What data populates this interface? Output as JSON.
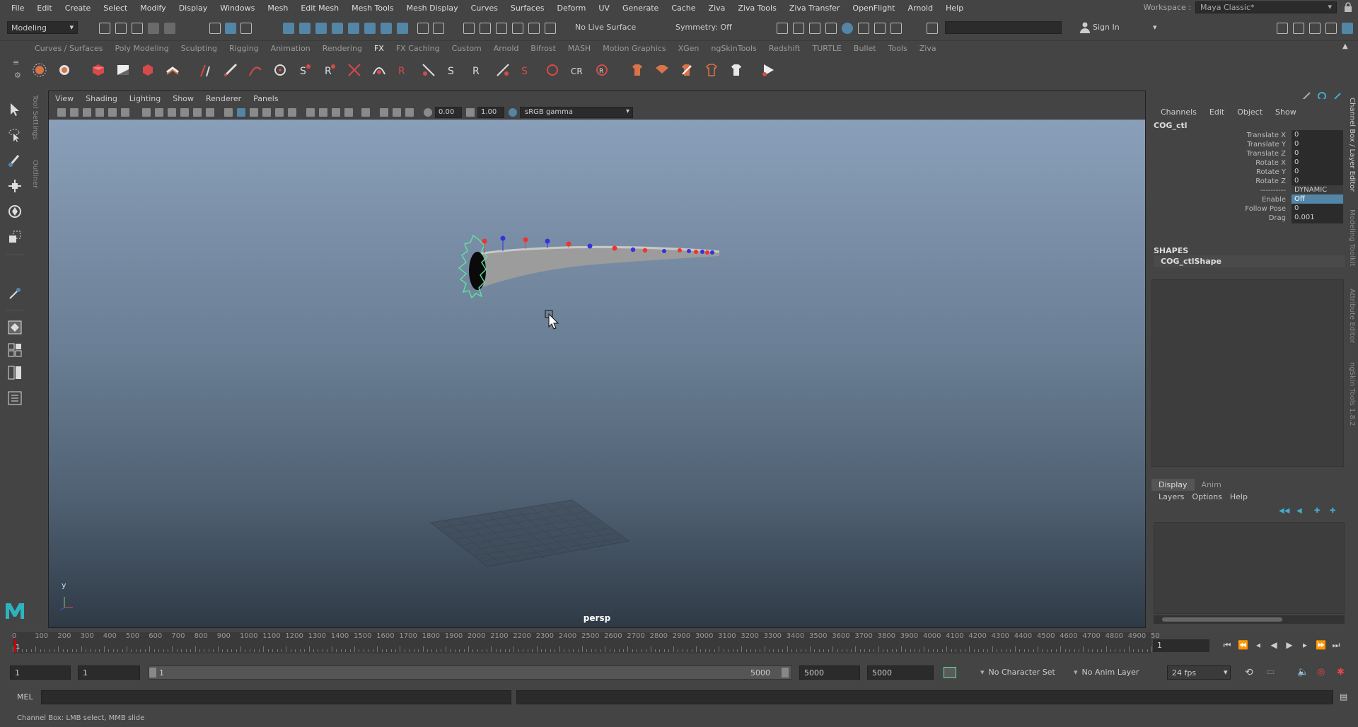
{
  "menubar": {
    "items": [
      "File",
      "Edit",
      "Create",
      "Select",
      "Modify",
      "Display",
      "Windows",
      "Mesh",
      "Edit Mesh",
      "Mesh Tools",
      "Mesh Display",
      "Curves",
      "Surfaces",
      "Deform",
      "UV",
      "Generate",
      "Cache",
      "Ziva",
      "Ziva Tools",
      "Ziva Transfer",
      "OpenFlight",
      "Arnold",
      "Help"
    ],
    "workspace_label": "Workspace :",
    "workspace_value": "Maya Classic*"
  },
  "statusline": {
    "mode": "Modeling",
    "live_surface": "No Live Surface",
    "symmetry": "Symmetry: Off",
    "sign_in": "Sign In"
  },
  "shelf": {
    "tabs": [
      "Curves / Surfaces",
      "Poly Modeling",
      "Sculpting",
      "Rigging",
      "Animation",
      "Rendering",
      "FX",
      "FX Caching",
      "Custom",
      "Arnold",
      "Bifrost",
      "MASH",
      "Motion Graphics",
      "XGen",
      "ngSkinTools",
      "Redshift",
      "TURTLE",
      "Bullet",
      "Tools",
      "Ziva"
    ],
    "active_tab": "FX"
  },
  "side_tabs": {
    "tool_settings": "Tool Settings",
    "outliner": "Outliner",
    "channel_box": "Channel Box / Layer Editor",
    "modeling_toolkit": "Modeling Toolkit",
    "attribute_editor": "Attribute Editor",
    "ngskin": "ngSkin Tools 1.8.2"
  },
  "viewport": {
    "menus": [
      "View",
      "Shading",
      "Lighting",
      "Show",
      "Renderer",
      "Panels"
    ],
    "exposure": "0.00",
    "gamma": "1.00",
    "color_space": "sRGB gamma",
    "camera": "persp",
    "axis_y": "y"
  },
  "channelbox": {
    "menus": [
      "Channels",
      "Edit",
      "Object",
      "Show"
    ],
    "object": "COG_ctl",
    "attributes": [
      {
        "label": "Translate X",
        "value": "0"
      },
      {
        "label": "Translate Y",
        "value": "0"
      },
      {
        "label": "Translate Z",
        "value": "0"
      },
      {
        "label": "Rotate X",
        "value": "0"
      },
      {
        "label": "Rotate Y",
        "value": "0"
      },
      {
        "label": "Rotate Z",
        "value": "0"
      },
      {
        "label": "----------",
        "value": "DYNAMIC"
      },
      {
        "label": "Enable",
        "value": "Off"
      },
      {
        "label": "Follow Pose",
        "value": "0"
      },
      {
        "label": "Drag",
        "value": "0.001"
      }
    ],
    "shapes_header": "SHAPES",
    "shape": "COG_ctlShape"
  },
  "layereditor": {
    "tabs": [
      "Display",
      "Anim"
    ],
    "active_tab": "Display",
    "menus": [
      "Layers",
      "Options",
      "Help"
    ]
  },
  "timeslider": {
    "ticks": [
      "0",
      "100",
      "200",
      "300",
      "400",
      "500",
      "600",
      "700",
      "800",
      "900",
      "1000",
      "1100",
      "1200",
      "1300",
      "1400",
      "1500",
      "1600",
      "1700",
      "1800",
      "1900",
      "2000",
      "2100",
      "2200",
      "2300",
      "2400",
      "2500",
      "2600",
      "2700",
      "2800",
      "2900",
      "3000",
      "3100",
      "3200",
      "3300",
      "3400",
      "3500",
      "3600",
      "3700",
      "3800",
      "3900",
      "4000",
      "4100",
      "4200",
      "4300",
      "4400",
      "4500",
      "4600",
      "4700",
      "4800",
      "4900",
      "50"
    ],
    "current_frame": "1",
    "playhead_label": "1"
  },
  "rangeslider": {
    "start_frame": "1",
    "playback_start": "1",
    "range_start": "1",
    "range_end": "5000",
    "playback_end": "5000",
    "end_frame": "5000",
    "character_set": "No Character Set",
    "anim_layer": "No Anim Layer",
    "fps": "24 fps"
  },
  "cmdline": {
    "label": "MEL"
  },
  "helpline": {
    "text": "Channel Box: LMB select, MMB slide"
  }
}
